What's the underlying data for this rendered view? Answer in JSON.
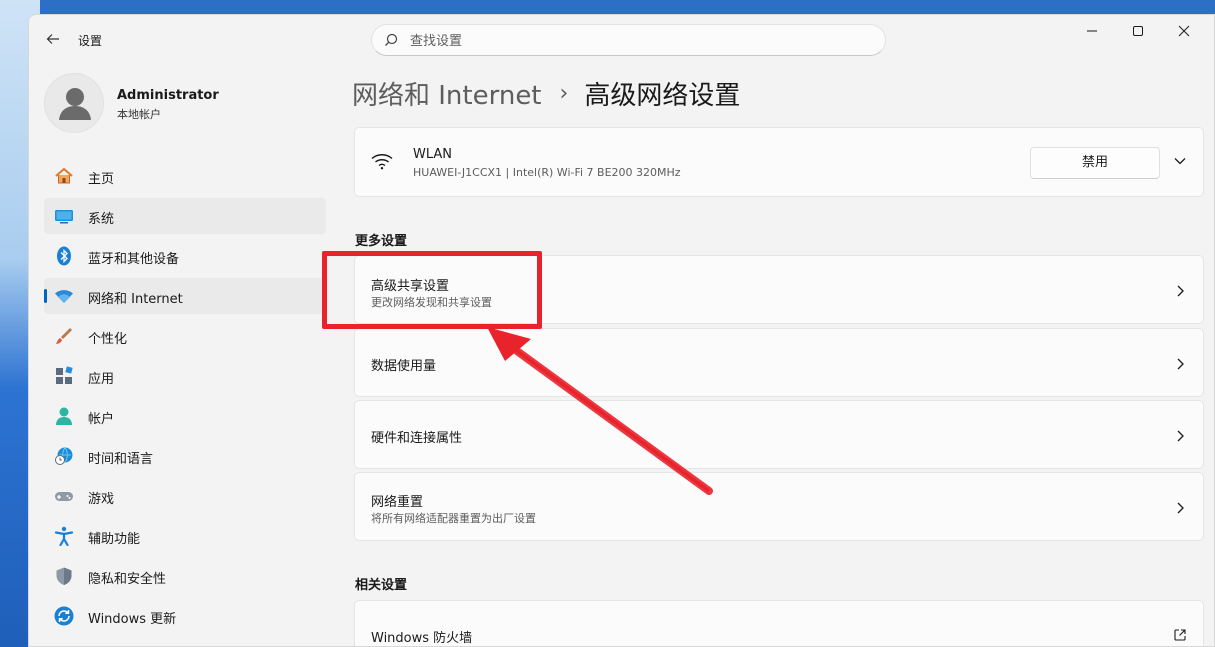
{
  "window": {
    "title": "设置",
    "controls": {
      "minimize": "—",
      "maximize": "☐",
      "close": "✕"
    }
  },
  "search": {
    "placeholder": "查找设置"
  },
  "user": {
    "name": "Administrator",
    "account_type": "本地帐户"
  },
  "sidebar": {
    "items": [
      {
        "label": "主页",
        "icon": "home-icon"
      },
      {
        "label": "系统",
        "icon": "system-icon"
      },
      {
        "label": "蓝牙和其他设备",
        "icon": "bluetooth-icon"
      },
      {
        "label": "网络和 Internet",
        "icon": "network-icon"
      },
      {
        "label": "个性化",
        "icon": "personalization-icon"
      },
      {
        "label": "应用",
        "icon": "apps-icon"
      },
      {
        "label": "帐户",
        "icon": "account-icon"
      },
      {
        "label": "时间和语言",
        "icon": "time-language-icon"
      },
      {
        "label": "游戏",
        "icon": "gaming-icon"
      },
      {
        "label": "辅助功能",
        "icon": "accessibility-icon"
      },
      {
        "label": "隐私和安全性",
        "icon": "privacy-icon"
      },
      {
        "label": "Windows 更新",
        "icon": "windows-update-icon"
      }
    ]
  },
  "breadcrumb": {
    "parent": "网络和 Internet",
    "separator": "›",
    "current": "高级网络设置"
  },
  "adapter": {
    "name": "WLAN",
    "detail": "HUAWEI-J1CCX1 | Intel(R) Wi-Fi 7 BE200 320MHz",
    "disable_label": "禁用"
  },
  "more_settings": {
    "title": "更多设置",
    "items": [
      {
        "title": "高级共享设置",
        "subtitle": "更改网络发现和共享设置"
      },
      {
        "title": "数据使用量",
        "subtitle": ""
      },
      {
        "title": "硬件和连接属性",
        "subtitle": ""
      },
      {
        "title": "网络重置",
        "subtitle": "将所有网络适配器重置为出厂设置"
      }
    ]
  },
  "related_settings": {
    "title": "相关设置",
    "items": [
      {
        "title": "Windows 防火墙"
      }
    ]
  },
  "colors": {
    "accent": "#0067c0",
    "annotation_red": "#e8232b",
    "window_bg": "#f3f3f3",
    "card_bg": "#fbfbfb"
  }
}
